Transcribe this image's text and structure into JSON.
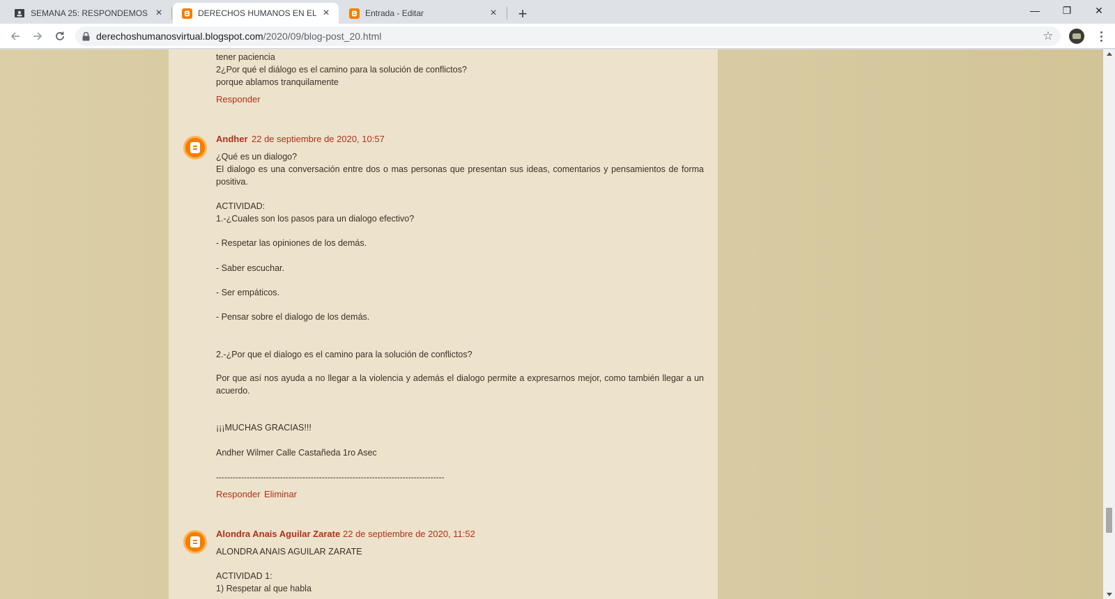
{
  "browser": {
    "tabs": [
      {
        "title": "SEMANA 25: RESPONDEMOS",
        "close": "×"
      },
      {
        "title": "DERECHOS HUMANOS EN EL MU",
        "close": "×"
      },
      {
        "title": "Entrada - Editar",
        "close": "×"
      }
    ],
    "new_tab": "+",
    "url_host": "derechoshumanosvirtual.blogspot.com",
    "url_path": "/2020/09/blog-post_20.html",
    "window_controls": {
      "minimize": "—",
      "restore": "❐",
      "close": "✕"
    }
  },
  "comments": {
    "prev": {
      "lines": [
        "tener paciencia",
        "2¿Por qué el diálogo es el camino para la solución de conflictos?",
        "porque ablamos tranquilamente"
      ],
      "reply": "Responder"
    },
    "andher": {
      "author": "Andher",
      "date": "22 de septiembre de 2020, 10:57",
      "q1": "¿Qué es un dialogo?",
      "p1": "El dialogo es una conversación entre dos o mas personas que presentan sus ideas, comentarios y pensamientos de forma positiva.",
      "actividad": "ACTIVIDAD:",
      "q2": "1.-¿Cuales son los pasos para un dialogo efectivo?",
      "steps": [
        "- Respetar las opiniones de los demás.",
        "- Saber escuchar.",
        "- Ser empáticos.",
        "- Pensar sobre el dialogo de los demás."
      ],
      "q3": "2.-¿Por que el dialogo es el camino para la solución de conflictos?",
      "p2": "Por que así nos ayuda a no llegar a la violencia y además el dialogo permite a expresarnos mejor, como también llegar a un acuerdo.",
      "thanks": "¡¡¡MUCHAS GRACIAS!!!",
      "signature": "Andher Wilmer Calle Castañeda 1ro Asec",
      "rule": "----------------------------------------------------------------------------------",
      "reply": "Responder",
      "delete": "Eliminar"
    },
    "alondra": {
      "author": "Alondra Anais Aguilar Zarate",
      "date": "22 de septiembre de 2020, 11:52",
      "l1": "ALONDRA ANAIS AGUILAR ZARATE",
      "l2": "ACTIVIDAD 1:",
      "l3": "1) Respetar al que habla"
    }
  }
}
